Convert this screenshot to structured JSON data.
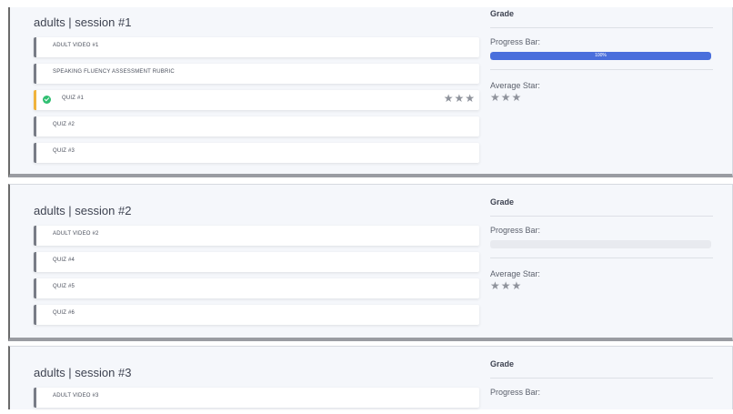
{
  "sessions": [
    {
      "title": "adults | session #1",
      "items": [
        {
          "label": "ADULT VIDEO #1"
        },
        {
          "label": "SPEAKING FLUENCY ASSESSMENT RUBRIC"
        },
        {
          "label": "QUIZ #1",
          "completed": true,
          "stars": "★★★"
        },
        {
          "label": "QUIZ #2"
        },
        {
          "label": "QUIZ #3"
        }
      ],
      "grade": {
        "title": "Grade",
        "progress_label": "Progress Bar:",
        "progress_percent": 100,
        "progress_text": "100%",
        "avg_label": "Average Star:",
        "avg_stars": "★★★"
      }
    },
    {
      "title": "adults | session #2",
      "items": [
        {
          "label": "ADULT VIDEO #2"
        },
        {
          "label": "QUIZ #4"
        },
        {
          "label": "QUIZ #5"
        },
        {
          "label": "QUIZ #6"
        }
      ],
      "grade": {
        "title": "Grade",
        "progress_label": "Progress Bar:",
        "progress_percent": 0,
        "avg_label": "Average Star:",
        "avg_stars": "★★★"
      }
    },
    {
      "title": "adults | session #3",
      "items": [
        {
          "label": "ADULT VIDEO #3"
        }
      ],
      "grade": {
        "title": "Grade",
        "progress_label": "Progress Bar:"
      }
    }
  ],
  "colors": {
    "progress_fill": "#4a6fdc",
    "active_border": "#f0b33d",
    "check": "#2fbf71",
    "star": "#8f939c"
  }
}
